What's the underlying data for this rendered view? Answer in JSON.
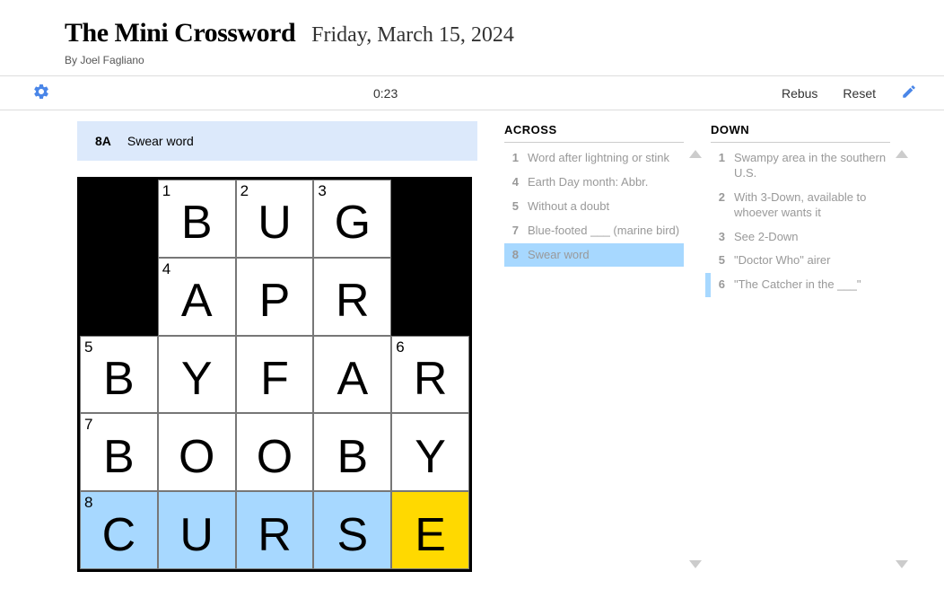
{
  "header": {
    "title": "The Mini Crossword",
    "date": "Friday, March 15, 2024",
    "byline": "By Joel Fagliano"
  },
  "toolbar": {
    "timer": "0:23",
    "rebus_label": "Rebus",
    "reset_label": "Reset",
    "settings_icon": "gear-icon",
    "pencil_icon": "pencil-icon"
  },
  "current_clue": {
    "number": "8A",
    "text": "Swear word"
  },
  "grid": {
    "size": 5,
    "cells": [
      {
        "black": true
      },
      {
        "num": "1",
        "letter": "B"
      },
      {
        "num": "2",
        "letter": "U"
      },
      {
        "num": "3",
        "letter": "G"
      },
      {
        "black": true
      },
      {
        "black": true
      },
      {
        "num": "4",
        "letter": "A"
      },
      {
        "letter": "P"
      },
      {
        "letter": "R"
      },
      {
        "black": true
      },
      {
        "num": "5",
        "letter": "B"
      },
      {
        "letter": "Y"
      },
      {
        "letter": "F"
      },
      {
        "letter": "A"
      },
      {
        "num": "6",
        "letter": "R"
      },
      {
        "num": "7",
        "letter": "B"
      },
      {
        "letter": "O"
      },
      {
        "letter": "O"
      },
      {
        "letter": "B"
      },
      {
        "letter": "Y"
      },
      {
        "num": "8",
        "letter": "C",
        "hl": true
      },
      {
        "letter": "U",
        "hl": true
      },
      {
        "letter": "R",
        "hl": true
      },
      {
        "letter": "S",
        "hl": true
      },
      {
        "letter": "E",
        "cursor": true
      }
    ]
  },
  "clues": {
    "across": {
      "heading": "ACROSS",
      "items": [
        {
          "num": "1",
          "text": "Word after lightning or stink"
        },
        {
          "num": "4",
          "text": "Earth Day month: Abbr."
        },
        {
          "num": "5",
          "text": "Without a doubt"
        },
        {
          "num": "7",
          "text": "Blue-footed ___ (marine bird)"
        },
        {
          "num": "8",
          "text": "Swear word",
          "sel": true
        }
      ]
    },
    "down": {
      "heading": "DOWN",
      "items": [
        {
          "num": "1",
          "text": "Swampy area in the southern U.S."
        },
        {
          "num": "2",
          "text": "With 3-Down, available to whoever wants it"
        },
        {
          "num": "3",
          "text": "See 2-Down"
        },
        {
          "num": "5",
          "text": "\"Doctor Who\" airer"
        },
        {
          "num": "6",
          "text": "\"The Catcher in the ___\"",
          "cross": true
        }
      ]
    }
  }
}
